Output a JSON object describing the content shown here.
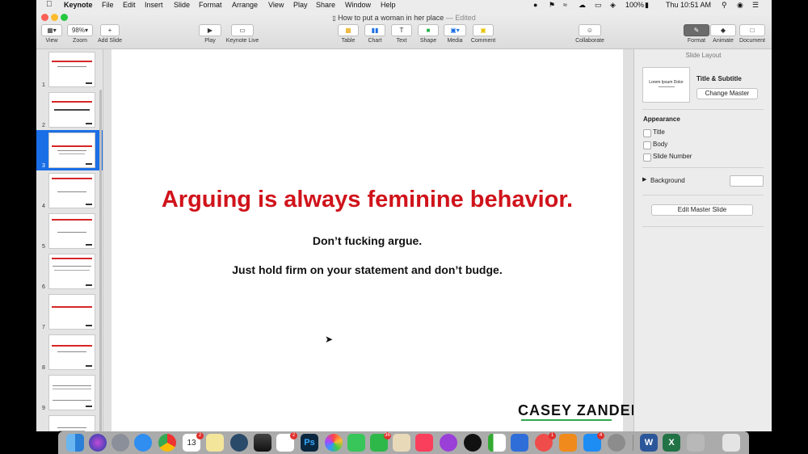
{
  "menubar": {
    "app_name": "Keynote",
    "items": [
      "File",
      "Edit",
      "Insert",
      "Slide",
      "Format",
      "Arrange",
      "View",
      "Play",
      "Share",
      "Window",
      "Help"
    ],
    "battery": "100%",
    "clock": "Thu 10:51 AM"
  },
  "window": {
    "doc_title": "How to put a woman in her place",
    "doc_status": "— Edited"
  },
  "toolbar": {
    "view_label": "View",
    "zoom_value": "98%",
    "zoom_label": "Zoom",
    "add_slide_label": "Add Slide",
    "play_label": "Play",
    "keynote_live_label": "Keynote Live",
    "table_label": "Table",
    "chart_label": "Chart",
    "text_label": "Text",
    "shape_label": "Shape",
    "media_label": "Media",
    "comment_label": "Comment",
    "collaborate_label": "Collaborate",
    "format_label": "Format",
    "animate_label": "Animate",
    "document_label": "Document"
  },
  "navigator": {
    "selected": 3,
    "slides": [
      "1",
      "2",
      "3",
      "4",
      "5",
      "6",
      "7",
      "8",
      "9"
    ]
  },
  "slide": {
    "title": "Arguing is always feminine behavior.",
    "line1": "Don’t fucking argue.",
    "line2": "Just hold firm on your statement and don’t budge.",
    "logo": "CASEY ZANDER"
  },
  "inspector": {
    "header": "Slide Layout",
    "master_preview_title": "Lorem Ipsum Dolor",
    "master_name": "Title & Subtitle",
    "change_master": "Change Master",
    "appearance_heading": "Appearance",
    "appearance_options": [
      "Title",
      "Body",
      "Slide Number"
    ],
    "background_label": "Background",
    "edit_master": "Edit Master Slide"
  },
  "dock": {
    "calendar_day": "13",
    "badges": {
      "calendar": "2",
      "reminders": "2",
      "facetime": "36",
      "news": "1",
      "appstore": "4"
    }
  },
  "colors": {
    "accent_blue": "#1b6fe6",
    "title_red": "#d0131b",
    "logo_green": "#2fa84f"
  }
}
